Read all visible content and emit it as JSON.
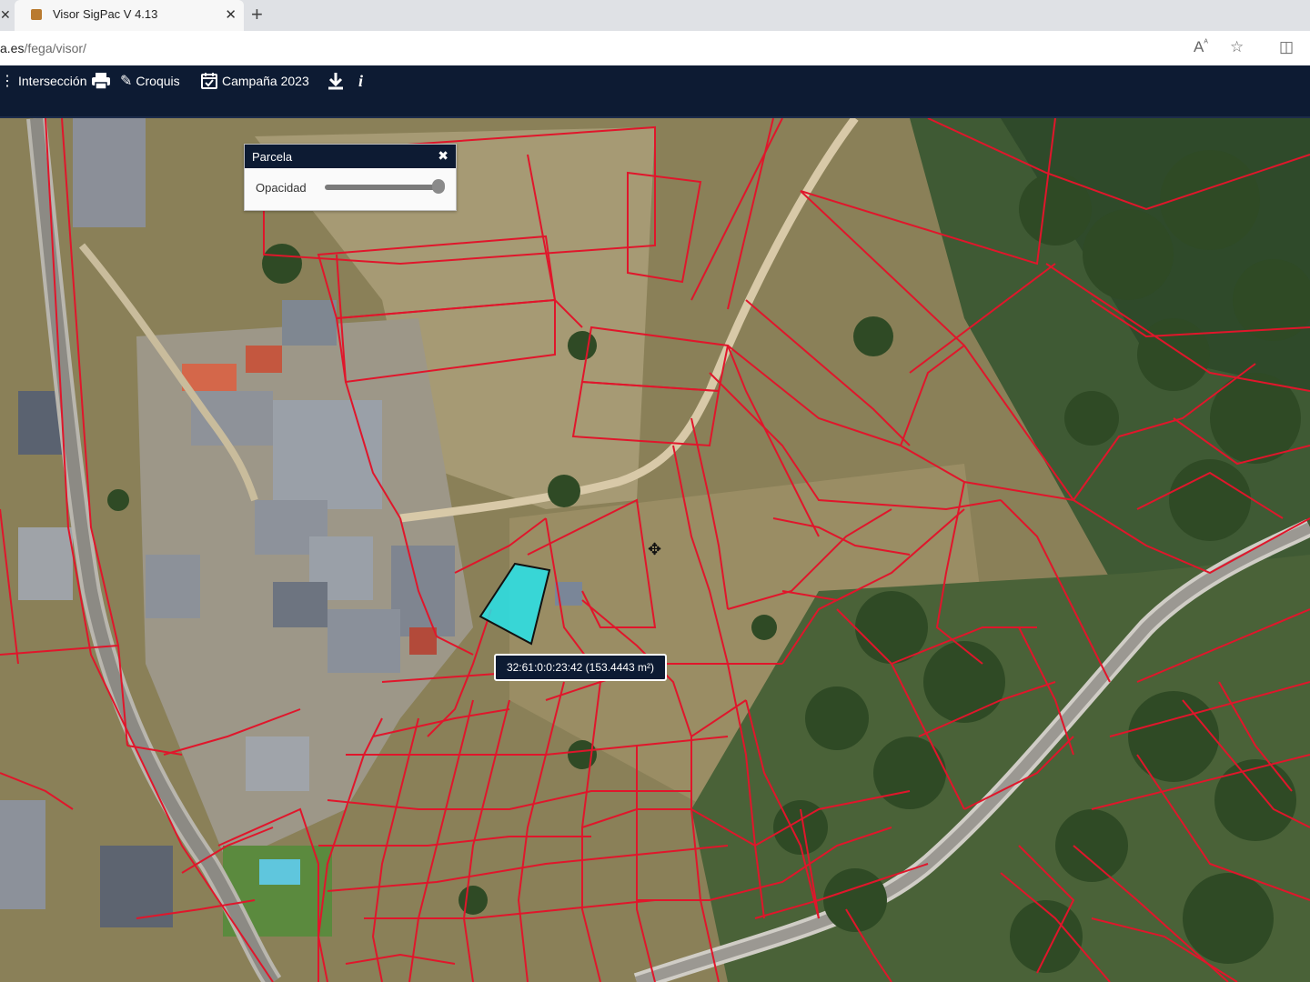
{
  "browser": {
    "tab_title": "Visor SigPac V 4.13",
    "url_host": "a.es",
    "url_path": "/fega/visor/"
  },
  "toolbar": {
    "interseccion": "Intersección",
    "croquis": "Croquis",
    "campana": "Campaña 2023",
    "info": "i"
  },
  "panel": {
    "title": "Parcela",
    "opacity_label": "Opacidad",
    "opacity_value": 1.0
  },
  "tooltip": {
    "text": "32:61:0:0:23:42 (153.4443 m²)"
  },
  "colors": {
    "toolbar_bg": "#0d1b33",
    "parcel_line": "#e0162b",
    "selected_parcel": "#27e3ea"
  }
}
